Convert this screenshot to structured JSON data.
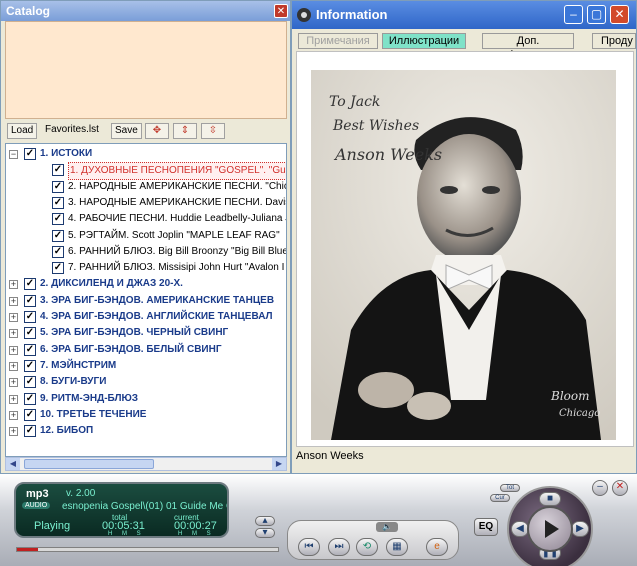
{
  "catalog": {
    "title": "Catalog",
    "toolbar": {
      "load": "Load",
      "file": "Favorites.lst",
      "save": "Save"
    },
    "tree": [
      {
        "label": "1. ИСТОКИ",
        "bold": true,
        "level": 0,
        "expanded": true
      },
      {
        "label": "1. ДУХОВНЫЕ ПЕСНОПЕНИЯ \"GOSPEL\". \"Guide",
        "bold": false,
        "level": 1,
        "selected": true
      },
      {
        "label": "2. НАРОДНЫЕ АМЕРИКАНСКИЕ ПЕСНИ. \"Chick",
        "bold": false,
        "level": 1
      },
      {
        "label": "3. НАРОДНЫЕ АМЕРИКАНСКИЕ ПЕСНИ. Davis",
        "bold": false,
        "level": 1
      },
      {
        "label": "4. РАБОЧИЕ ПЕСНИ. Huddie Leadbelly-Juliana J",
        "bold": false,
        "level": 1
      },
      {
        "label": "5. РЭГТАЙМ. Scott Joplin \"MAPLE LEAF RAG\"",
        "bold": false,
        "level": 1
      },
      {
        "label": "6. РАННИЙ БЛЮЗ. Big Bill Broonzy \"Big Bill Blue",
        "bold": false,
        "level": 1
      },
      {
        "label": "7. РАННИЙ БЛЮЗ. Missisipi John Hurt \"Avalon I",
        "bold": false,
        "level": 1
      },
      {
        "label": "2. ДИКСИЛЕНД И ДЖАЗ 20-Х.",
        "bold": true,
        "level": 0
      },
      {
        "label": "3. ЭРА БИГ-БЭНДОВ. АМЕРИКАНСКИЕ ТАНЦЕВ",
        "bold": true,
        "level": 0
      },
      {
        "label": "4. ЭРА БИГ-БЭНДОВ. АНГЛИЙСКИЕ ТАНЦЕВАЛ",
        "bold": true,
        "level": 0
      },
      {
        "label": "5. ЭРА БИГ-БЭНДОВ. ЧЕРНЫЙ СВИНГ",
        "bold": true,
        "level": 0
      },
      {
        "label": "6. ЭРА БИГ-БЭНДОВ. БЕЛЫЙ СВИНГ",
        "bold": true,
        "level": 0
      },
      {
        "label": "7. МЭЙНСТРИМ",
        "bold": true,
        "level": 0
      },
      {
        "label": "8. БУГИ-ВУГИ",
        "bold": true,
        "level": 0
      },
      {
        "label": "9. РИТМ-ЭНД-БЛЮЗ",
        "bold": true,
        "level": 0
      },
      {
        "label": "10. ТРЕТЬЕ ТЕЧЕНИЕ",
        "bold": true,
        "level": 0
      },
      {
        "label": "12. БИБОП",
        "bold": true,
        "level": 0
      }
    ]
  },
  "info": {
    "title": "Information",
    "tabs": [
      "Примечания",
      "Иллюстрации",
      "Доп. информация",
      "Проду"
    ],
    "active_tab": 1,
    "photo_inscription": [
      "To Jack",
      "Best Wishes",
      "Anson Weeks"
    ],
    "photo_stamp": [
      "Bloom",
      "Chicago"
    ],
    "caption": "Anson Weeks"
  },
  "player": {
    "logo": "mp3",
    "version": "v. 2.00",
    "audio_badge": "AUDIO",
    "track": "esnopenia Gospel\\(01) 01 Guide Me C",
    "state": "Playing",
    "total_label": "total",
    "current_label": "current",
    "total": "00:05:31",
    "current": "00:00:27",
    "hms": "H M S",
    "eq": "EQ",
    "progress": 0.08,
    "colors": {
      "lcd_text": "#7af0d0",
      "accent": "#c02020"
    }
  }
}
